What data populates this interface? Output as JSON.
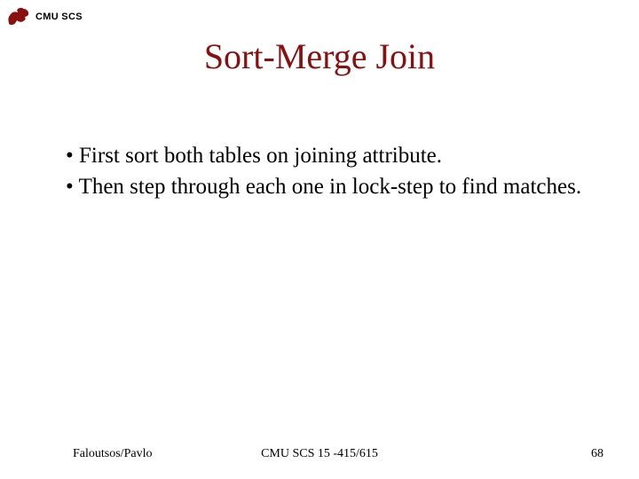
{
  "header": {
    "org": "CMU SCS"
  },
  "title": "Sort-Merge Join",
  "bullets": [
    "First sort both tables on joining attribute.",
    "Then step through each one in lock-step to find matches."
  ],
  "footer": {
    "left": "Faloutsos/Pavlo",
    "center": "CMU SCS 15 -415/615",
    "right": "68"
  }
}
